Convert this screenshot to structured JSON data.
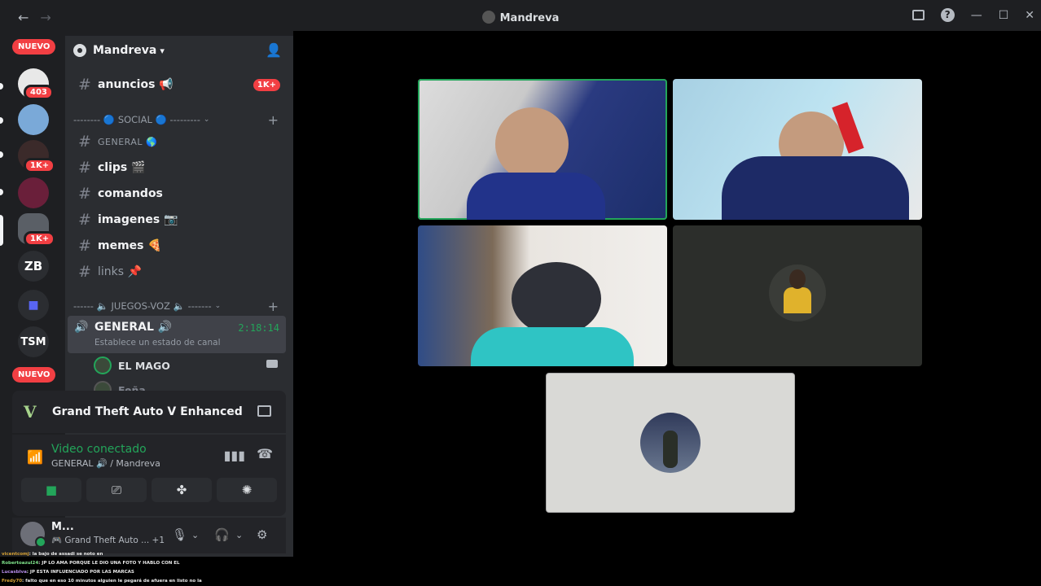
{
  "window": {
    "title": "Mandreva"
  },
  "rail": {
    "nuevo_top": "NUEVO",
    "nuevo_bottom": "NUEVO",
    "badges": [
      "403",
      "1K+",
      "1K+"
    ],
    "zb_label": "ZB",
    "tsm_label": "TSM"
  },
  "server": {
    "name": "Mandreva"
  },
  "channels": {
    "anuncios": {
      "name": "anuncios 📢",
      "badge": "1K+"
    },
    "cat_social": "-------- 🔵 SOCIAL 🔵 ---------",
    "general": "GENERAL 🌎",
    "clips": "clips 🎬",
    "comandos": "comandos",
    "imagenes": "imagenes 📷",
    "memes": "memes 🍕",
    "links": "links 📌",
    "cat_juegos": "------ 🔈 JUEGOS-VOZ 🔈 -------"
  },
  "voice_channel": {
    "name": "GENERAL 🔊",
    "timer": "2:18:14",
    "status_placeholder": "Establece un estado de canal",
    "users": [
      "EL MAGO",
      "Feña"
    ]
  },
  "activity": {
    "game": "Grand Theft Auto V Enhanced"
  },
  "rtc": {
    "status": "Video conectado",
    "location": "GENERAL 🔊 / Mandreva"
  },
  "user_panel": {
    "name": "M...",
    "status": "🎮 Grand Theft Auto ...",
    "extra": "+1"
  },
  "chat_overlay": [
    {
      "name": "vicentcomj",
      "text": ": la bajo de assadi se noto en"
    },
    {
      "name": "Robertoazul24",
      "text": ": JP LO AMA PORQUE LE DIO UNA FOTO Y HABLO CON EL"
    },
    {
      "name": "Lucasblva",
      "text": ": JP ESTA INFLUENCIADO POR LAS MARCAS"
    },
    {
      "name": "Fredy70",
      "text": ": falto que en eso 10 minutos alguien le pegará de afuera en listo no la"
    }
  ],
  "colors": {
    "accent_green": "#23a55a",
    "badge_red": "#f23f43",
    "sidebar_bg": "#2b2d31",
    "rail_bg": "#1e1f22"
  }
}
